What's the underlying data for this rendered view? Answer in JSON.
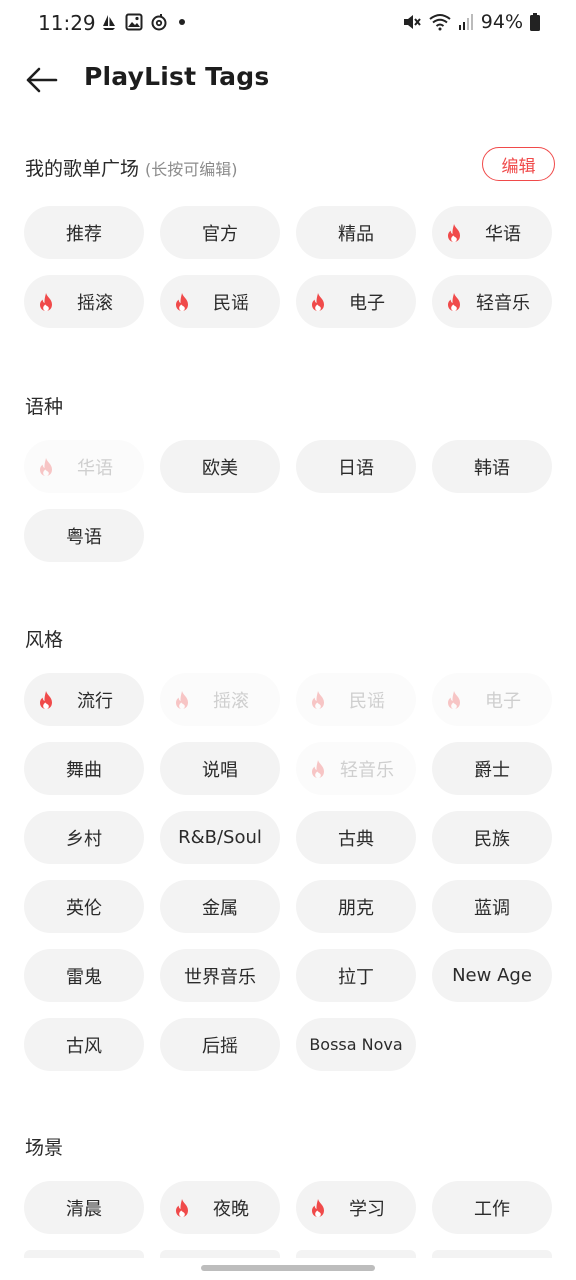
{
  "status_bar": {
    "time": "11:29",
    "battery": "94%"
  },
  "header": {
    "title": "PlayList Tags"
  },
  "my_square": {
    "title": "我的歌单广场",
    "hint": "(长按可编辑)",
    "edit_label": "编辑",
    "tags": [
      {
        "label": "推荐",
        "hot": false,
        "faded": false
      },
      {
        "label": "官方",
        "hot": false,
        "faded": false
      },
      {
        "label": "精品",
        "hot": false,
        "faded": false
      },
      {
        "label": "华语",
        "hot": true,
        "faded": false
      },
      {
        "label": "摇滚",
        "hot": true,
        "faded": false
      },
      {
        "label": "民谣",
        "hot": true,
        "faded": false
      },
      {
        "label": "电子",
        "hot": true,
        "faded": false
      },
      {
        "label": "轻音乐",
        "hot": true,
        "faded": false
      }
    ]
  },
  "language": {
    "title": "语种",
    "tags": [
      {
        "label": "华语",
        "hot": true,
        "faded": true
      },
      {
        "label": "欧美",
        "hot": false,
        "faded": false
      },
      {
        "label": "日语",
        "hot": false,
        "faded": false
      },
      {
        "label": "韩语",
        "hot": false,
        "faded": false
      },
      {
        "label": "粤语",
        "hot": false,
        "faded": false
      }
    ]
  },
  "style": {
    "title": "风格",
    "tags": [
      {
        "label": "流行",
        "hot": true,
        "faded": false
      },
      {
        "label": "摇滚",
        "hot": true,
        "faded": true
      },
      {
        "label": "民谣",
        "hot": true,
        "faded": true
      },
      {
        "label": "电子",
        "hot": true,
        "faded": true
      },
      {
        "label": "舞曲",
        "hot": false,
        "faded": false
      },
      {
        "label": "说唱",
        "hot": false,
        "faded": false
      },
      {
        "label": "轻音乐",
        "hot": true,
        "faded": true
      },
      {
        "label": "爵士",
        "hot": false,
        "faded": false
      },
      {
        "label": "乡村",
        "hot": false,
        "faded": false
      },
      {
        "label": "R&B/Soul",
        "hot": false,
        "faded": false
      },
      {
        "label": "古典",
        "hot": false,
        "faded": false
      },
      {
        "label": "民族",
        "hot": false,
        "faded": false
      },
      {
        "label": "英伦",
        "hot": false,
        "faded": false
      },
      {
        "label": "金属",
        "hot": false,
        "faded": false
      },
      {
        "label": "朋克",
        "hot": false,
        "faded": false
      },
      {
        "label": "蓝调",
        "hot": false,
        "faded": false
      },
      {
        "label": "雷鬼",
        "hot": false,
        "faded": false
      },
      {
        "label": "世界音乐",
        "hot": false,
        "faded": false
      },
      {
        "label": "拉丁",
        "hot": false,
        "faded": false
      },
      {
        "label": "New Age",
        "hot": false,
        "faded": false
      },
      {
        "label": "古风",
        "hot": false,
        "faded": false
      },
      {
        "label": "后摇",
        "hot": false,
        "faded": false
      },
      {
        "label": "Bossa Nova",
        "hot": false,
        "faded": false
      }
    ]
  },
  "scene": {
    "title": "场景",
    "tags": [
      {
        "label": "清晨",
        "hot": false,
        "faded": false
      },
      {
        "label": "夜晚",
        "hot": true,
        "faded": false
      },
      {
        "label": "学习",
        "hot": true,
        "faded": false
      },
      {
        "label": "工作",
        "hot": false,
        "faded": false
      }
    ]
  },
  "icons": {
    "back": "arrow-left-icon",
    "hot": "flame-icon",
    "accent_color": "#f04a4a"
  }
}
